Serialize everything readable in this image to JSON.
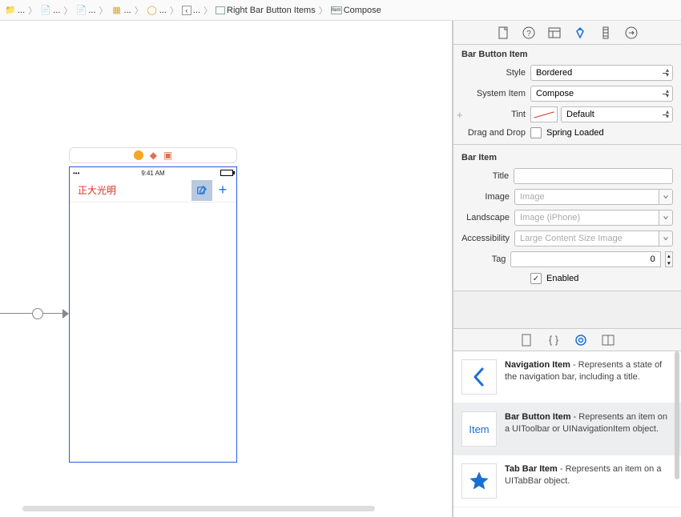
{
  "breadcrumb": {
    "items": [
      {
        "icon": "folder",
        "label": "..."
      },
      {
        "icon": "file",
        "label": "..."
      },
      {
        "icon": "file",
        "label": "..."
      },
      {
        "icon": "storyboard",
        "label": "..."
      },
      {
        "icon": "scene",
        "label": "..."
      },
      {
        "icon": "back-arrow",
        "label": "..."
      },
      {
        "icon": "view",
        "label": "Right Bar Button Items"
      },
      {
        "icon": "item",
        "label": "Compose"
      }
    ]
  },
  "device": {
    "status_time": "9:41 AM",
    "nav_title": "正大光明"
  },
  "inspector": {
    "section1_title": "Bar Button Item",
    "style_label": "Style",
    "style_value": "Bordered",
    "system_item_label": "System Item",
    "system_item_value": "Compose",
    "tint_label": "Tint",
    "tint_value": "Default",
    "dragdrop_label": "Drag and Drop",
    "spring_loaded_label": "Spring Loaded",
    "section2_title": "Bar Item",
    "title_label": "Title",
    "title_value": "",
    "image_label": "Image",
    "image_placeholder": "Image",
    "landscape_label": "Landscape",
    "landscape_placeholder": "Image (iPhone)",
    "accessibility_label": "Accessibility",
    "accessibility_placeholder": "Large Content Size Image",
    "tag_label": "Tag",
    "tag_value": "0",
    "enabled_label": "Enabled"
  },
  "library": [
    {
      "title": "Navigation Item",
      "desc": " - Represents a state of the navigation bar, including a title.",
      "icon": "chevron-left",
      "selected": false
    },
    {
      "title": "Bar Button Item",
      "desc": " - Represents an item on a UIToolbar or UINavigationItem object.",
      "icon": "item-text",
      "selected": true
    },
    {
      "title": "Tab Bar Item",
      "desc": " - Represents an item on a UITabBar object.",
      "icon": "star",
      "selected": false
    }
  ]
}
